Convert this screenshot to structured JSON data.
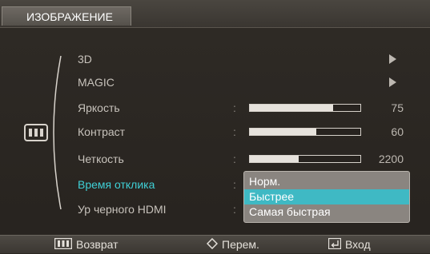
{
  "title": "ИЗОБРАЖЕНИЕ",
  "menu": {
    "items": [
      {
        "label": "3D",
        "control": "arrow"
      },
      {
        "label": "MAGIC",
        "control": "arrow"
      },
      {
        "label": "Яркость",
        "control": "slider",
        "level": 0.75,
        "value": "75"
      },
      {
        "label": "Контраст",
        "control": "slider",
        "level": 0.6,
        "value": "60"
      },
      {
        "label": "Четкость",
        "control": "slider",
        "level": 0.44,
        "value": "2200"
      },
      {
        "label": "Время отклика",
        "control": "dropdown",
        "active": true
      },
      {
        "label": "Ур черного HDMI",
        "control": "none"
      }
    ],
    "colon": ":"
  },
  "dropdown": {
    "options": [
      "Норм.",
      "Быстрее",
      "Самая быстрая"
    ],
    "selected": "Быстрее"
  },
  "footer": {
    "back_label": "Возврат",
    "move_label": "Перем.",
    "enter_label": "Вход"
  },
  "colors": {
    "accent": "#3fd0d6",
    "selection": "#3fb9c4",
    "background": "#2b2722"
  },
  "icons": {
    "menu": "menu-bars-icon",
    "move": "diamond-arrows-icon",
    "enter": "enter-icon",
    "arrow": "arrow-right-icon"
  }
}
